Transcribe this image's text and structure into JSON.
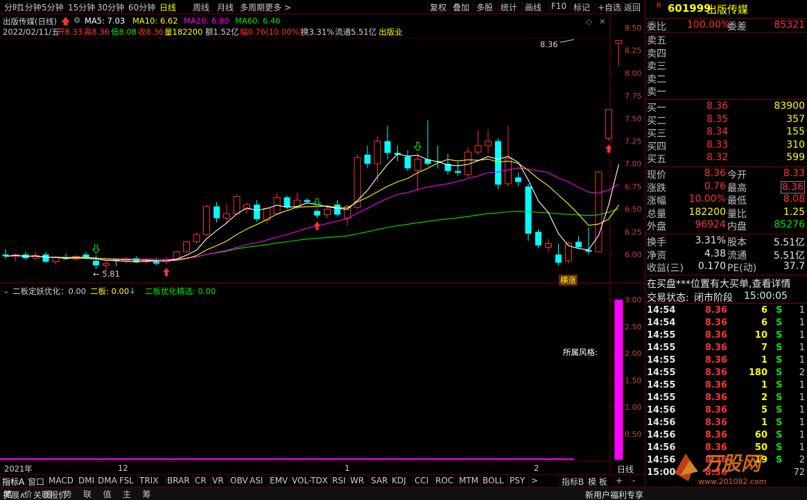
{
  "menu": {
    "left": [
      "分时",
      "1分钟",
      "5分钟",
      "15分钟",
      "30分钟",
      "60分钟",
      "日线",
      "周线",
      "月线",
      "多周期",
      "更多 >"
    ],
    "active": "日线",
    "right": [
      "复权",
      "叠加",
      "多股",
      "统计",
      "画线",
      "F10",
      "标记",
      "+自选",
      "返回"
    ]
  },
  "chart_info": {
    "title": "出版传媒(日线)",
    "ma5": "MA5: 7.03",
    "ma10": "MA10: 6.62",
    "ma20": "MA20: 6.80",
    "ma60": "MA60: 6.46",
    "date": "2022/02/11/五",
    "open": "开8.33",
    "high": "高8.36",
    "low": "低8.08",
    "close": "收8.36",
    "vol": "量182200",
    "amount": "额1.52亿",
    "change": "幅0.76(10.00%)",
    "turnover": "换3.31%",
    "float_cap": "流通5.51亿",
    "industry": "出版业",
    "high_label": "8.36",
    "low_label": "5.81",
    "tag": "横涨"
  },
  "indicator_info": {
    "name": "二板定妖优化：0.00",
    "second": "二板: 0.00",
    "third": "二板优化精选: 0.00",
    "style_label": "所属风格:"
  },
  "axis": {
    "price_ticks": [
      "8.50",
      "8.25",
      "8.00",
      "7.75",
      "7.50",
      "7.25",
      "7.00",
      "6.75",
      "6.50",
      "6.25",
      "6.00"
    ],
    "ind_ticks": [
      "3.00",
      "2.50",
      "2.00",
      "1.50",
      "1.00",
      "0.50"
    ],
    "x_labels": [
      "2021年",
      "12",
      "1",
      "2"
    ],
    "period": "日线"
  },
  "colors": {
    "up": "#ff3232",
    "down": "#00ffff",
    "ma5": "#ffffff",
    "ma10": "#ffff00",
    "ma20": "#ff00ff",
    "ma60": "#00e600",
    "grid": "#7a0000"
  },
  "chart_data": {
    "type": "candlestick",
    "x": [
      "1",
      "2",
      "3",
      "4",
      "5",
      "6",
      "7",
      "8",
      "9",
      "10",
      "11",
      "12",
      "13",
      "14",
      "15",
      "16",
      "17",
      "18",
      "19",
      "20",
      "21",
      "22",
      "23",
      "24",
      "25",
      "26",
      "27",
      "28",
      "29",
      "30",
      "31",
      "32",
      "33",
      "34",
      "35",
      "36",
      "37",
      "38",
      "39",
      "40",
      "41",
      "42",
      "43",
      "44",
      "45",
      "46",
      "47",
      "48",
      "49",
      "50",
      "51",
      "52",
      "53",
      "54",
      "55"
    ],
    "ohlc": [
      [
        6.0,
        6.06,
        5.95,
        5.98
      ],
      [
        5.98,
        6.01,
        5.93,
        6.0
      ],
      [
        6.0,
        6.03,
        5.94,
        5.96
      ],
      [
        5.96,
        6.03,
        5.94,
        5.99
      ],
      [
        6.0,
        6.03,
        5.91,
        5.92
      ],
      [
        5.92,
        5.98,
        5.89,
        5.97
      ],
      [
        5.97,
        6.01,
        5.94,
        5.95
      ],
      [
        5.95,
        5.99,
        5.93,
        5.98
      ],
      [
        6.0,
        6.03,
        5.95,
        5.97
      ],
      [
        5.93,
        5.99,
        5.84,
        5.88
      ],
      [
        5.88,
        5.93,
        5.81,
        5.9
      ],
      [
        5.94,
        5.96,
        5.87,
        5.93
      ],
      [
        5.93,
        5.97,
        5.9,
        5.95
      ],
      [
        5.96,
        5.98,
        5.91,
        5.92
      ],
      [
        5.92,
        5.96,
        5.89,
        5.94
      ],
      [
        5.92,
        5.96,
        5.88,
        5.9
      ],
      [
        5.92,
        5.96,
        5.89,
        5.95
      ],
      [
        5.95,
        6.04,
        5.95,
        6.03
      ],
      [
        6.03,
        6.15,
        6.02,
        6.14
      ],
      [
        6.14,
        6.24,
        6.12,
        6.22
      ],
      [
        6.22,
        6.55,
        6.2,
        6.53
      ],
      [
        6.53,
        6.58,
        6.35,
        6.4
      ],
      [
        6.4,
        6.55,
        6.34,
        6.45
      ],
      [
        6.45,
        6.66,
        6.43,
        6.64
      ],
      [
        6.5,
        6.58,
        6.45,
        6.55
      ],
      [
        6.55,
        6.6,
        6.36,
        6.39
      ],
      [
        6.38,
        6.52,
        6.34,
        6.51
      ],
      [
        6.45,
        6.68,
        6.43,
        6.63
      ],
      [
        6.63,
        6.65,
        6.5,
        6.52
      ],
      [
        6.52,
        6.68,
        6.5,
        6.6
      ],
      [
        6.6,
        6.62,
        6.56,
        6.58
      ],
      [
        6.48,
        6.5,
        6.4,
        6.43
      ],
      [
        6.44,
        6.53,
        6.4,
        6.5
      ],
      [
        6.55,
        6.6,
        6.42,
        6.44
      ],
      [
        6.4,
        6.55,
        6.32,
        6.53
      ],
      [
        6.52,
        7.1,
        6.5,
        7.07
      ],
      [
        7.1,
        7.2,
        6.95,
        7.0
      ],
      [
        7.0,
        7.3,
        6.8,
        7.25
      ],
      [
        7.25,
        7.42,
        7.05,
        7.12
      ],
      [
        7.12,
        7.2,
        7.03,
        7.1
      ],
      [
        7.08,
        7.15,
        6.92,
        6.95
      ],
      [
        6.93,
        7.12,
        6.7,
        7.05
      ],
      [
        7.05,
        7.48,
        6.98,
        7.0
      ],
      [
        7.03,
        7.2,
        6.95,
        7.02
      ],
      [
        7.0,
        7.11,
        6.88,
        6.92
      ],
      [
        6.92,
        7.02,
        6.87,
        6.9
      ],
      [
        6.88,
        7.18,
        6.85,
        7.13
      ],
      [
        7.13,
        7.37,
        7.1,
        7.2
      ],
      [
        7.2,
        7.38,
        7.12,
        7.25
      ],
      [
        7.25,
        7.28,
        6.72,
        6.77
      ],
      [
        6.78,
        7.42,
        6.75,
        7.06
      ],
      [
        6.85,
        6.9,
        6.75,
        6.8
      ],
      [
        6.75,
        6.78,
        6.15,
        6.23
      ],
      [
        6.25,
        6.28,
        6.07,
        6.1
      ],
      [
        6.08,
        6.17,
        6.02,
        6.12
      ]
    ],
    "ohlc_tail": [
      [
        6.0,
        6.12,
        5.88,
        5.91
      ],
      [
        5.93,
        6.15,
        5.9,
        6.12
      ],
      [
        6.14,
        6.2,
        6.06,
        6.08
      ],
      [
        6.05,
        6.3,
        6.0,
        6.03
      ],
      [
        6.03,
        6.92,
        6.03,
        6.91
      ],
      [
        7.28,
        7.6,
        7.25,
        7.6
      ],
      [
        8.33,
        8.36,
        8.08,
        8.36
      ]
    ],
    "volume_indicator": {
      "name": "二板定妖优化",
      "last_bar": 3.0
    },
    "ylim": [
      5.8,
      8.55
    ],
    "ind_ylim": [
      0,
      3.2
    ]
  },
  "panel": {
    "code_flag": "R",
    "code": "601999",
    "name": "出版传媒",
    "weibi_label": "委比",
    "weibi": "100.00%",
    "weicha_label": "委差",
    "weicha": "85321",
    "sells": [
      {
        "label": "卖五",
        "price": "",
        "vol": ""
      },
      {
        "label": "卖四",
        "price": "",
        "vol": ""
      },
      {
        "label": "卖三",
        "price": "",
        "vol": ""
      },
      {
        "label": "卖二",
        "price": "",
        "vol": ""
      },
      {
        "label": "卖一",
        "price": "",
        "vol": ""
      }
    ],
    "buys": [
      {
        "label": "买一",
        "price": "8.36",
        "vol": "83900"
      },
      {
        "label": "买二",
        "price": "8.35",
        "vol": "357"
      },
      {
        "label": "买三",
        "price": "8.34",
        "vol": "155"
      },
      {
        "label": "买四",
        "price": "8.33",
        "vol": "310"
      },
      {
        "label": "买五",
        "price": "8.32",
        "vol": "599"
      }
    ],
    "stats": [
      {
        "l1": "现价",
        "v1": "8.36",
        "l2": "今开",
        "v2": "8.33",
        "c1": "red",
        "c2": "red"
      },
      {
        "l1": "涨跌",
        "v1": "0.76",
        "l2": "最高",
        "v2": "8.36",
        "c1": "red",
        "c2": "red"
      },
      {
        "l1": "涨幅",
        "v1": "10.00%",
        "l2": "最低",
        "v2": "8.08",
        "c1": "red",
        "c2": "red"
      },
      {
        "l1": "总量",
        "v1": "182200",
        "l2": "量比",
        "v2": "1.25",
        "c1": "yellow",
        "c2": "yellow"
      },
      {
        "l1": "外盘",
        "v1": "96924",
        "l2": "内盘",
        "v2": "85276",
        "c1": "red",
        "c2": "green"
      }
    ],
    "stats2": [
      {
        "l1": "换手",
        "v1": "3.31%",
        "l2": "股本",
        "v2": "5.51亿"
      },
      {
        "l1": "净资",
        "v1": "4.38",
        "l2": "流通",
        "v2": "5.51亿"
      },
      {
        "l1": "收益(三)",
        "v1": "0.170",
        "l2": "PE(动)",
        "v2": "37.7"
      }
    ],
    "notice": "在买盘***位置有大买单,查看详情",
    "trade_state_label": "交易状态:",
    "trade_state": "闭市阶段",
    "trade_time": "15:00:05",
    "ticks": [
      {
        "t": "14:54",
        "p": "8.36",
        "v": "6",
        "s": "S",
        "n": "1"
      },
      {
        "t": "14:54",
        "p": "8.36",
        "v": "6",
        "s": "S",
        "n": "1"
      },
      {
        "t": "14:55",
        "p": "8.36",
        "v": "10",
        "s": "S",
        "n": "1"
      },
      {
        "t": "14:55",
        "p": "8.36",
        "v": "7",
        "s": "S",
        "n": "1"
      },
      {
        "t": "14:55",
        "p": "8.36",
        "v": "1",
        "s": "S",
        "n": "1"
      },
      {
        "t": "14:55",
        "p": "8.36",
        "v": "180",
        "s": "S",
        "n": "2"
      },
      {
        "t": "14:55",
        "p": "8.36",
        "v": "1",
        "s": "S",
        "n": "1"
      },
      {
        "t": "14:55",
        "p": "8.36",
        "v": "2",
        "s": "S",
        "n": "1"
      },
      {
        "t": "14:56",
        "p": "8.36",
        "v": "5",
        "s": "S",
        "n": "1"
      },
      {
        "t": "14:56",
        "p": "8.36",
        "v": "1",
        "s": "S",
        "n": "1"
      },
      {
        "t": "14:56",
        "p": "8.36",
        "v": "60",
        "s": "S",
        "n": "1"
      },
      {
        "t": "14:56",
        "p": "8.36",
        "v": "50",
        "s": "S",
        "n": "1"
      },
      {
        "t": "14:56",
        "p": "8.36",
        "v": "19",
        "s": "S",
        "n": "2"
      },
      {
        "t": "15:00",
        "p": "8.36",
        "v": "",
        "s": "",
        "n": "72"
      }
    ],
    "tabs": [
      "笔",
      "价",
      "细",
      "势",
      "联",
      "值",
      "主",
      "筹"
    ]
  },
  "tabbar": {
    "left": "指标A",
    "items": [
      "窗口",
      "MACD",
      "DMI",
      "DMA",
      "FSL",
      "TRIX",
      "BRAR",
      "CR",
      "VR",
      "OBV",
      "ASI",
      "EMV",
      "VOL-TDX",
      "RSI",
      "WR",
      "SAR",
      "KDJ",
      "CCI",
      "ROC",
      "MTM",
      "BOLL",
      "PSY"
    ],
    "more": ">",
    "right": [
      "指标B",
      "模 板",
      "+",
      "-"
    ]
  },
  "bottom": {
    "left": [
      "扩展∧",
      "关联报价"
    ],
    "right": "新用户福利专享"
  },
  "watermark": "万股网 www.201082.com"
}
